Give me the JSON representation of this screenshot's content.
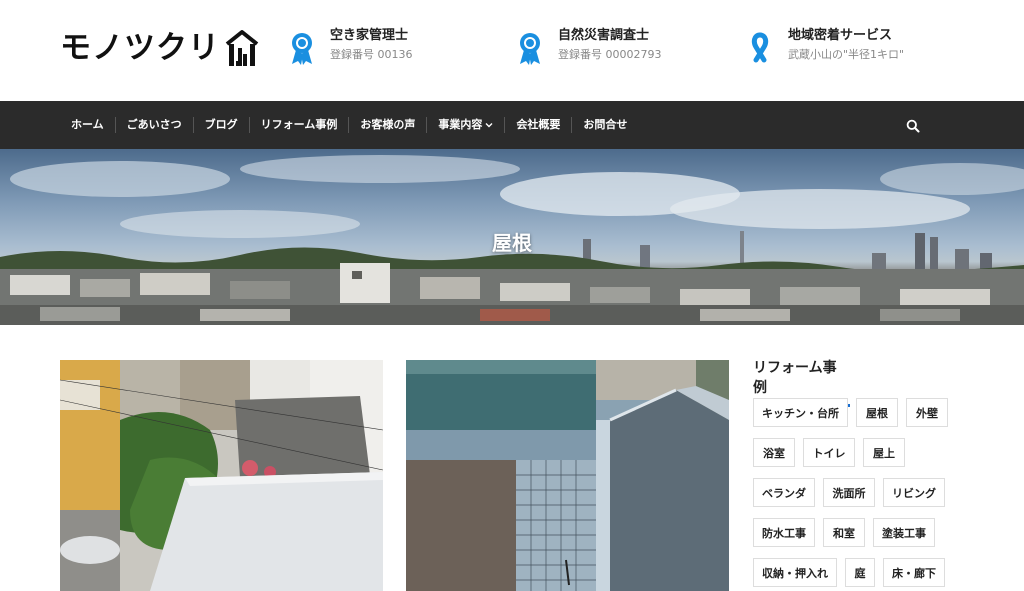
{
  "header": {
    "logo_text": "モノツクリ",
    "credentials": [
      {
        "title": "空き家管理士",
        "sub": "登録番号 00136",
        "icon": "award-ribbon-icon"
      },
      {
        "title": "自然災害調査士",
        "sub": "登録番号 00002793",
        "icon": "award-ribbon-icon"
      },
      {
        "title": "地域密着サービス",
        "sub": "武蔵小山の\"半径1キロ\"",
        "icon": "awareness-ribbon-icon"
      }
    ],
    "accent_color": "#1a8fe0"
  },
  "nav": {
    "items": [
      "ホーム",
      "ごあいさつ",
      "ブログ",
      "リフォーム事例",
      "お客様の声",
      "事業内容",
      "会社概要",
      "お問合せ"
    ],
    "search_icon": "search-icon",
    "background": "#2b2b2b"
  },
  "hero": {
    "title": "屋根"
  },
  "sidebar": {
    "title": "リフォーム事例",
    "tags": [
      "キッチン・台所",
      "屋根",
      "外壁",
      "浴室",
      "トイレ",
      "屋上",
      "ベランダ",
      "洗面所",
      "リビング",
      "防水工事",
      "和室",
      "塗装工事",
      "収納・押入れ",
      "庭",
      "床・廊下"
    ]
  }
}
